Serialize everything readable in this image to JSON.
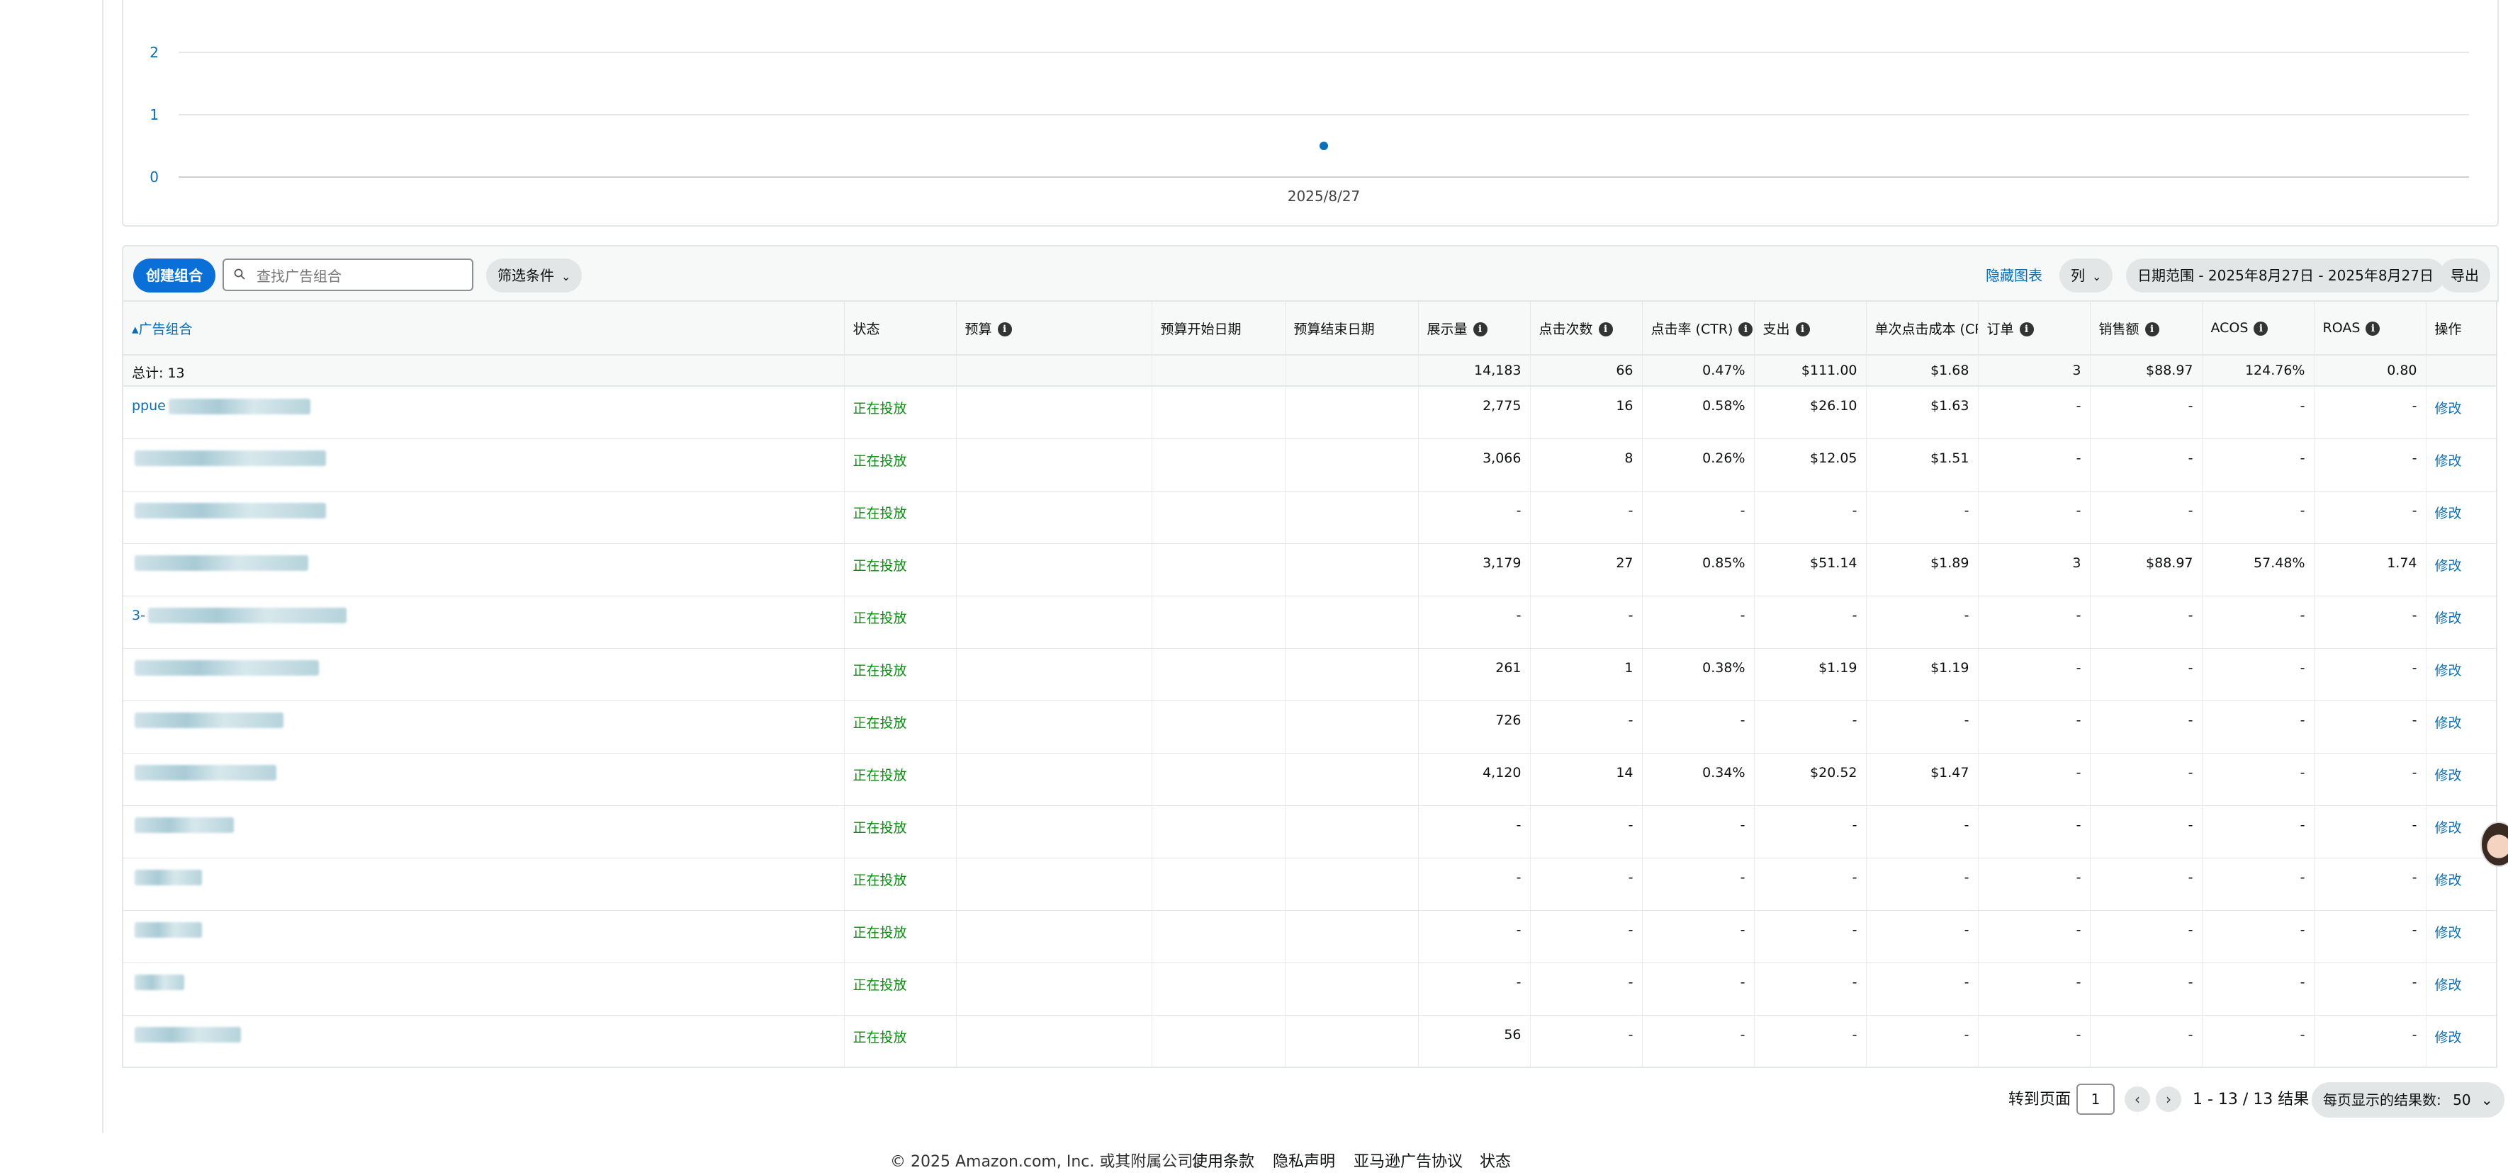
{
  "chart": {
    "y_ticks": [
      "2",
      "1",
      "0"
    ],
    "x_tick": "2025/8/27",
    "point_value": 0.5,
    "accent": "#0a6fb5"
  },
  "toolbar": {
    "create_label": "创建组合",
    "search_placeholder": "查找广告组合",
    "filter_label": "筛选条件",
    "hide_chart_label": "隐藏图表",
    "columns_label": "列",
    "date_range_label": "日期范围 - 2025年8月27日 - 2025年8月27日",
    "export_label": "导出"
  },
  "table": {
    "headers": {
      "portfolio": "广告组合",
      "status": "状态",
      "budget": "预算",
      "budget_start": "预算开始日期",
      "budget_end": "预算结束日期",
      "impressions": "展示量",
      "clicks": "点击次数",
      "ctr": "点击率 (CTR)",
      "spend": "支出",
      "cpc": "单次点击成本 (CPC)",
      "orders": "订单",
      "sales": "销售额",
      "acos": "ACOS",
      "roas": "ROAS",
      "action": "操作"
    },
    "total": {
      "label": "总计: 13",
      "impressions": "14,183",
      "clicks": "66",
      "ctr": "0.47%",
      "spend": "$111.00",
      "cpc": "$1.68",
      "orders": "3",
      "sales": "$88.97",
      "acos": "124.76%",
      "roas": "0.80"
    },
    "rows": [
      {
        "name_visible": "ppue",
        "status": "正在投放",
        "impressions": "2,775",
        "clicks": "16",
        "ctr": "0.58%",
        "spend": "$26.10",
        "cpc": "$1.63",
        "orders": "-",
        "sales": "-",
        "acos": "-",
        "roas": "-",
        "action": "修改"
      },
      {
        "name_visible": "",
        "status": "正在投放",
        "impressions": "3,066",
        "clicks": "8",
        "ctr": "0.26%",
        "spend": "$12.05",
        "cpc": "$1.51",
        "orders": "-",
        "sales": "-",
        "acos": "-",
        "roas": "-",
        "action": "修改"
      },
      {
        "name_visible": "",
        "status": "正在投放",
        "impressions": "-",
        "clicks": "-",
        "ctr": "-",
        "spend": "-",
        "cpc": "-",
        "orders": "-",
        "sales": "-",
        "acos": "-",
        "roas": "-",
        "action": "修改"
      },
      {
        "name_visible": "",
        "status": "正在投放",
        "impressions": "3,179",
        "clicks": "27",
        "ctr": "0.85%",
        "spend": "$51.14",
        "cpc": "$1.89",
        "orders": "3",
        "sales": "$88.97",
        "acos": "57.48%",
        "roas": "1.74",
        "action": "修改"
      },
      {
        "name_visible": "3-",
        "status": "正在投放",
        "impressions": "-",
        "clicks": "-",
        "ctr": "-",
        "spend": "-",
        "cpc": "-",
        "orders": "-",
        "sales": "-",
        "acos": "-",
        "roas": "-",
        "action": "修改"
      },
      {
        "name_visible": "",
        "status": "正在投放",
        "impressions": "261",
        "clicks": "1",
        "ctr": "0.38%",
        "spend": "$1.19",
        "cpc": "$1.19",
        "orders": "-",
        "sales": "-",
        "acos": "-",
        "roas": "-",
        "action": "修改"
      },
      {
        "name_visible": "",
        "status": "正在投放",
        "impressions": "726",
        "clicks": "-",
        "ctr": "-",
        "spend": "-",
        "cpc": "-",
        "orders": "-",
        "sales": "-",
        "acos": "-",
        "roas": "-",
        "action": "修改"
      },
      {
        "name_visible": "",
        "status": "正在投放",
        "impressions": "4,120",
        "clicks": "14",
        "ctr": "0.34%",
        "spend": "$20.52",
        "cpc": "$1.47",
        "orders": "-",
        "sales": "-",
        "acos": "-",
        "roas": "-",
        "action": "修改"
      },
      {
        "name_visible": "",
        "status": "正在投放",
        "impressions": "-",
        "clicks": "-",
        "ctr": "-",
        "spend": "-",
        "cpc": "-",
        "orders": "-",
        "sales": "-",
        "acos": "-",
        "roas": "-",
        "action": "修改"
      },
      {
        "name_visible": "",
        "status": "正在投放",
        "impressions": "-",
        "clicks": "-",
        "ctr": "-",
        "spend": "-",
        "cpc": "-",
        "orders": "-",
        "sales": "-",
        "acos": "-",
        "roas": "-",
        "action": "修改"
      },
      {
        "name_visible": "",
        "status": "正在投放",
        "impressions": "-",
        "clicks": "-",
        "ctr": "-",
        "spend": "-",
        "cpc": "-",
        "orders": "-",
        "sales": "-",
        "acos": "-",
        "roas": "-",
        "action": "修改"
      },
      {
        "name_visible": "",
        "status": "正在投放",
        "impressions": "-",
        "clicks": "-",
        "ctr": "-",
        "spend": "-",
        "cpc": "-",
        "orders": "-",
        "sales": "-",
        "acos": "-",
        "roas": "-",
        "action": "修改"
      },
      {
        "name_visible": "",
        "status": "正在投放",
        "impressions": "56",
        "clicks": "-",
        "ctr": "-",
        "spend": "-",
        "cpc": "-",
        "orders": "-",
        "sales": "-",
        "acos": "-",
        "roas": "-",
        "action": "修改"
      }
    ]
  },
  "pagination": {
    "goto_label": "转到页面",
    "page_value": "1",
    "prev_icon": "‹",
    "next_icon": "›",
    "range_text": "1 - 13 / 13 结果",
    "per_page_label": "每页显示的结果数:",
    "per_page_value": "50"
  },
  "footer": {
    "copyright": "© 2025 Amazon.com, Inc. 或其附属公司。",
    "links": [
      "使用条款",
      "隐私声明",
      "亚马逊广告协议",
      "状态"
    ]
  },
  "colors": {
    "primary": "#0a6fd6",
    "link": "#0a6fb5",
    "status_green": "#0c8a12"
  }
}
